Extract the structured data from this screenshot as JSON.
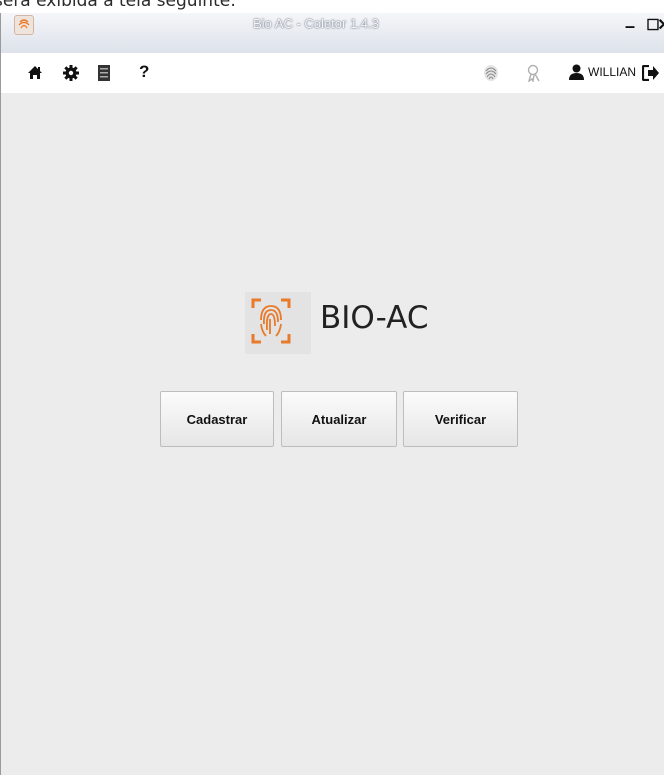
{
  "caption": "será exibida a tela seguinte:",
  "window": {
    "title": "Bio AC - Coletor 1.4.3",
    "controls": {
      "minimize": "–",
      "maximize": "☐",
      "close": "✕"
    }
  },
  "toolbar": {
    "help_label": "?",
    "user_name": "WILLIAN"
  },
  "logo": {
    "text": "BIO-AC",
    "accent_color": "#e87a2a"
  },
  "buttons": {
    "cadastrar": "Cadastrar",
    "atualizar": "Atualizar",
    "verificar": "Verificar"
  }
}
